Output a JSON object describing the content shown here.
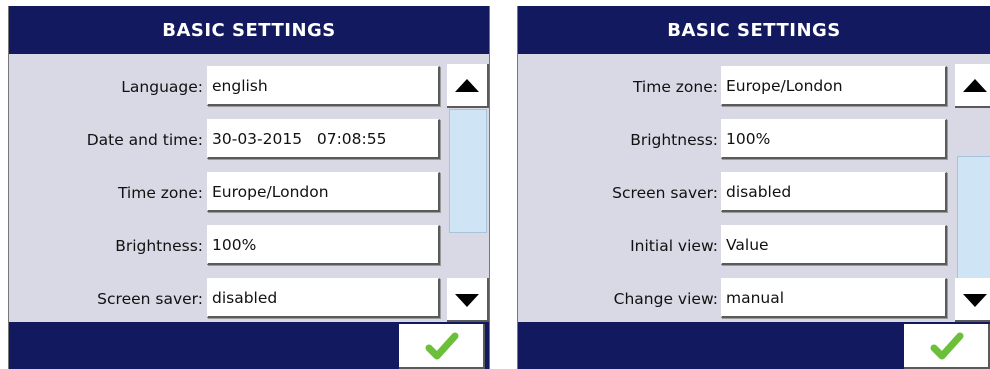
{
  "panels": [
    {
      "title": "BASIC SETTINGS",
      "rows": [
        {
          "label": "Language:",
          "value": "english"
        },
        {
          "label": "Date and time:",
          "value": "30-03-2015   07:08:55"
        },
        {
          "label": "Time zone:",
          "value": "Europe/London"
        },
        {
          "label": "Brightness:",
          "value": "100%"
        },
        {
          "label": "Screen saver:",
          "value": "disabled"
        }
      ],
      "scroll_up": "arrow-up-icon",
      "scroll_down": "arrow-down-icon",
      "confirm": "checkmark-icon"
    },
    {
      "title": "BASIC SETTINGS",
      "rows": [
        {
          "label": "Time zone:",
          "value": "Europe/London"
        },
        {
          "label": "Brightness:",
          "value": "100%"
        },
        {
          "label": "Screen saver:",
          "value": "disabled"
        },
        {
          "label": "Initial view:",
          "value": "Value"
        },
        {
          "label": "Change view:",
          "value": "manual"
        }
      ],
      "scroll_up": "arrow-up-icon",
      "scroll_down": "arrow-down-icon",
      "confirm": "checkmark-icon"
    }
  ],
  "colors": {
    "header": "#13195e",
    "panel_bg": "#d9d9e6",
    "scroll_thumb": "#cfe4f5",
    "check_green": "#6bbf3a"
  }
}
